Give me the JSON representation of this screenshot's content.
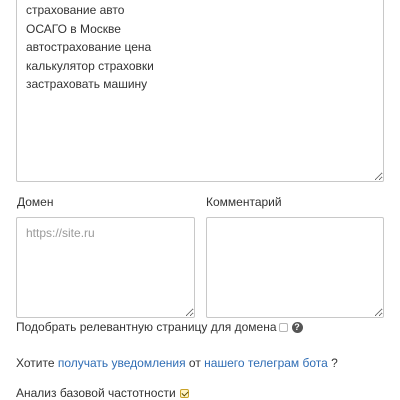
{
  "keywords": {
    "value": "страхование авто\nОСАГО в Москве\nавтострахование цена\nкалькулятор страховки\nзастраховать машину"
  },
  "domain": {
    "label": "Домен",
    "placeholder": "https://site.ru",
    "value": ""
  },
  "comment": {
    "label": "Комментарий",
    "value": ""
  },
  "match_page": {
    "label": "Подобрать релевантную страницу для домена",
    "checked": false,
    "help_icon": "question-circle-icon"
  },
  "telegram": {
    "prefix": "Хотите ",
    "link1": "получать уведомления",
    "middle": " от ",
    "link2": "нашего телеграм бота",
    "suffix": " ?"
  },
  "base_frequency": {
    "label": "Анализ базовой частотности",
    "checked": true
  },
  "colors": {
    "link": "#2f6db5",
    "checkbox_checked_bg": "#fff3c4"
  }
}
